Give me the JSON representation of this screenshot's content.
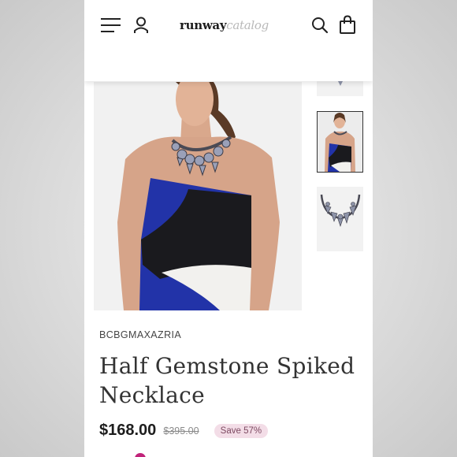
{
  "header": {
    "logo_primary": "runway",
    "logo_secondary": "catalog",
    "icons": [
      "menu-icon",
      "account-icon",
      "search-icon",
      "bag-icon"
    ]
  },
  "gallery": {
    "main_image": "model-wearing-necklace",
    "thumbnails": [
      "necklace-detail",
      "model-wearing-necklace",
      "necklace-flat"
    ],
    "selected_thumbnail": 1
  },
  "product": {
    "brand": "BCBGMAXAZRIA",
    "title": "Half Gemstone Spiked Necklace",
    "price": "$168.00",
    "original_price": "$395.00",
    "discount_badge": "Save 57%"
  },
  "colors": {
    "accent": "#c1237a",
    "badge_bg": "#f3dde7",
    "badge_text": "#7e4a62",
    "dress_blue": "#2233a8",
    "dress_black": "#1a1a1e",
    "dress_white": "#f2f1ee"
  }
}
